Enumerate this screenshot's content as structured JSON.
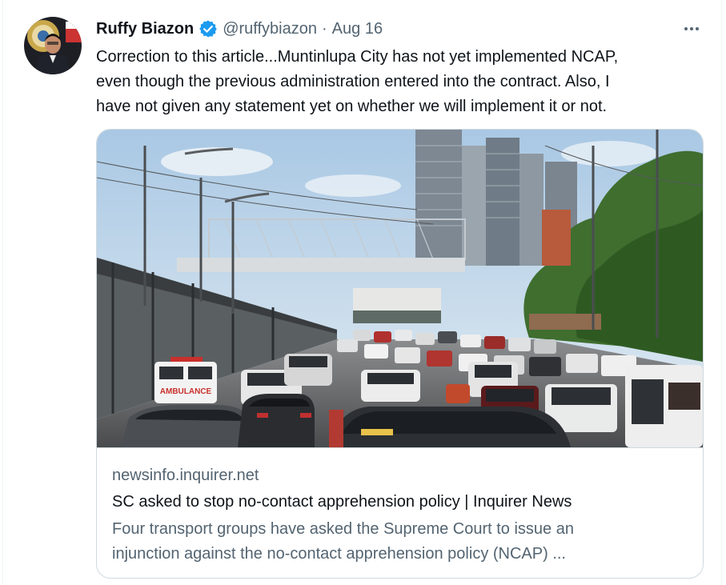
{
  "tweet": {
    "author": {
      "display_name": "Ruffy Biazon",
      "handle": "@ruffybiazon",
      "verified": true,
      "avatar_icon": "avatar-portrait"
    },
    "separator": "·",
    "timestamp": "Aug 16",
    "more_icon": "more-horizontal-icon",
    "text_lines": [
      "Correction to this article...Muntinlupa City has not yet implemented NCAP,",
      "even though the previous administration entered into the contract. Also, I",
      "have not given any statement yet on whether we will implement it or not."
    ],
    "card": {
      "image_icon": "traffic-photo",
      "domain": "newsinfo.inquirer.net",
      "title": "SC asked to stop no-contact apprehension policy | Inquirer News",
      "description_lines": [
        "Four transport groups have asked the Supreme Court to issue an",
        "injunction against the no-contact apprehension policy (NCAP) ..."
      ],
      "photo_sign_text": "AMBULANCE"
    }
  },
  "colors": {
    "primary_text": "#0f1419",
    "secondary_text": "#536471",
    "verified_blue": "#1d9bf0",
    "border": "#cfd9de"
  }
}
